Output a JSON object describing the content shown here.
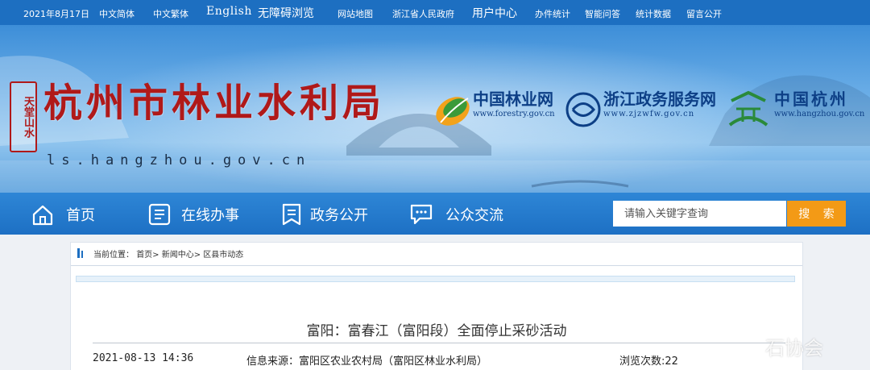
{
  "topbar": {
    "date": "2021年8月17日",
    "links": [
      "中文简体",
      "中文繁体"
    ],
    "english": "English",
    "accessibility": "无障碍浏览",
    "sitemap": "网站地图",
    "province": "浙江省人民政府",
    "user_center": "用户中心",
    "services": "办件统计",
    "qa": "智能问答",
    "stats": "统计数据",
    "messages": "留言公开"
  },
  "banner": {
    "seal_text": "天堂山水",
    "site_title": "杭州市林业水利局",
    "domain": "ls.hangzhou.gov.cn",
    "partners": [
      {
        "name": "中国林业网",
        "url": "www.forestry.gov.cn"
      },
      {
        "name": "浙江政务服务网",
        "url": "www.zjzwfw.gov.cn"
      },
      {
        "name": "中国杭州",
        "url": "www.hangzhou.gov.cn"
      }
    ]
  },
  "nav": {
    "items": [
      {
        "label": "首页",
        "icon": "home-icon"
      },
      {
        "label": "在线办事",
        "icon": "document-list-icon"
      },
      {
        "label": "政务公开",
        "icon": "bookmark-icon"
      },
      {
        "label": "公众交流",
        "icon": "chat-bubble-icon"
      }
    ],
    "search_placeholder": "请输入关键字查询",
    "search_button": "搜 索"
  },
  "breadcrumb": {
    "prefix": "当前位置：",
    "path": "首页> 新闻中心> 区县市动态"
  },
  "article": {
    "title": "富阳：富春江（富阳段）全面停止采砂活动",
    "date": "2021-08-13 14:36",
    "source": "信息来源：富阳区农业农村局（富阳区林业水利局）",
    "views": "浏览次数:22"
  },
  "watermark": "石协会",
  "colors": {
    "topbar": "#1d6fc1",
    "nav": "#1d70c4",
    "title_red": "#b01919",
    "search_button": "#f39a16"
  }
}
